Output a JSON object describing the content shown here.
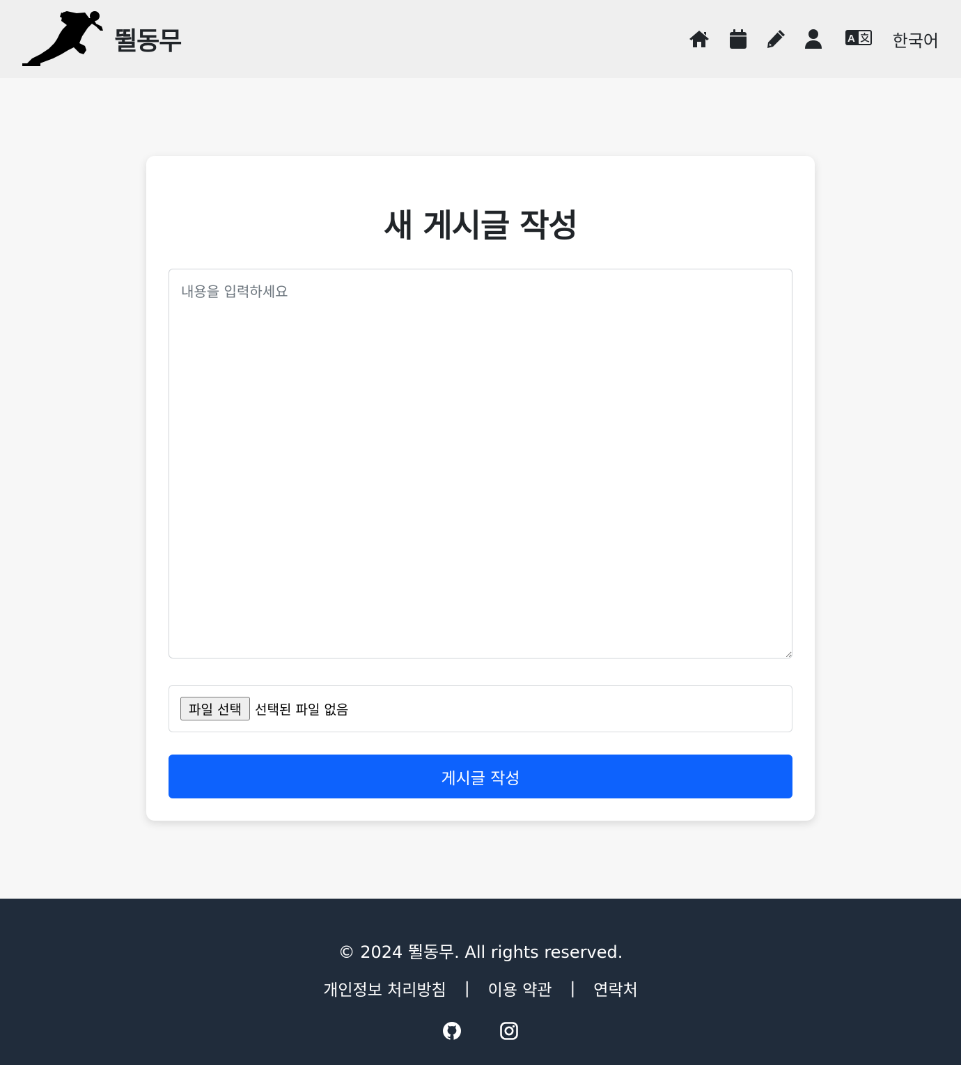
{
  "header": {
    "brand": "뛸동무",
    "logo_icon": "sprinter-silhouette-icon",
    "nav": [
      {
        "icon": "home-icon"
      },
      {
        "icon": "calendar-icon"
      },
      {
        "icon": "pencil-icon"
      },
      {
        "icon": "user-icon"
      }
    ],
    "language": {
      "icon": "translate-icon",
      "label": "한국어"
    }
  },
  "form": {
    "title": "새 게시글 작성",
    "content_placeholder": "내용을 입력하세요",
    "content_value": "",
    "file_button_label": "파일 선택",
    "file_status": "선택된 파일 없음",
    "submit_label": "게시글 작성"
  },
  "footer": {
    "copyright": "© 2024 뛸동무. All rights reserved.",
    "links": [
      {
        "label": "개인정보 처리방침"
      },
      {
        "label": "이용 약관"
      },
      {
        "label": "연락처"
      }
    ],
    "separator": "|",
    "socials": [
      {
        "icon": "github-icon"
      },
      {
        "icon": "instagram-icon"
      }
    ]
  },
  "colors": {
    "header_bg": "#efefef",
    "page_bg": "#f7f7f7",
    "primary": "#0d62fd",
    "footer_bg": "#202c3b"
  }
}
